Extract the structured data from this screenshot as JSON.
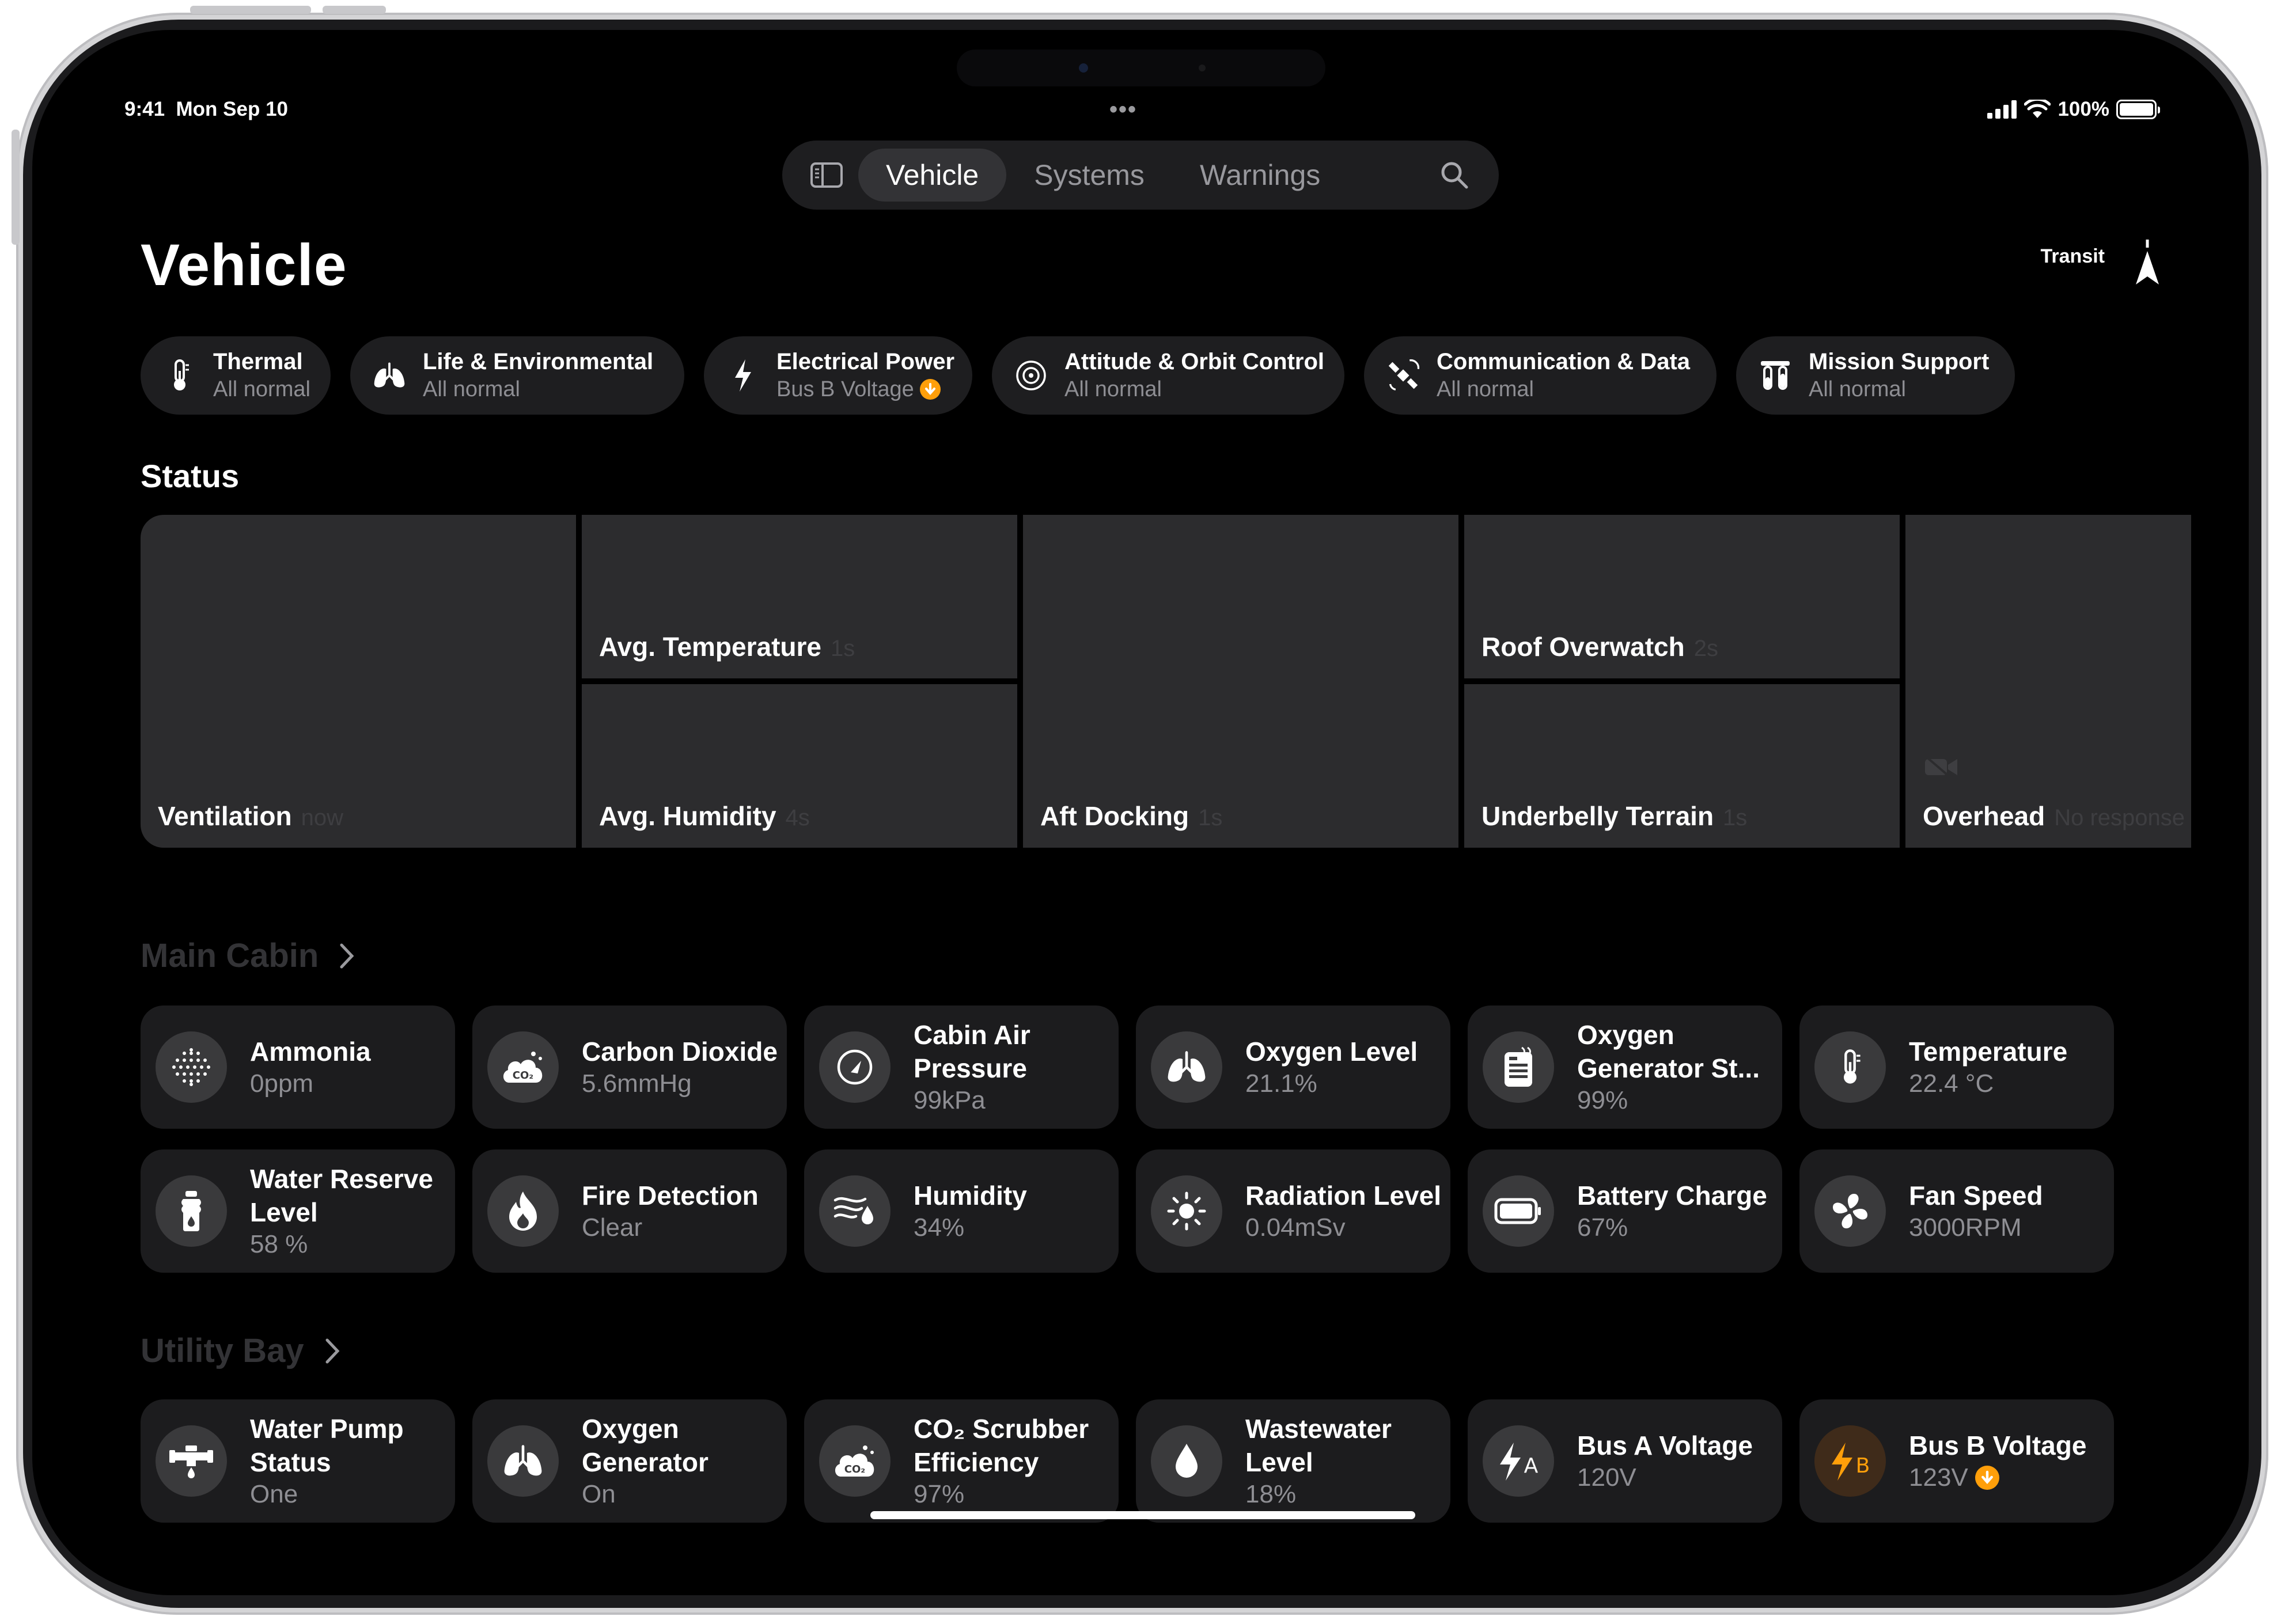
{
  "status_bar": {
    "time": "9:41",
    "date": "Mon Sep 10",
    "battery": "100%"
  },
  "tabs": [
    {
      "label": "Vehicle",
      "active": true
    },
    {
      "label": "Systems",
      "active": false
    },
    {
      "label": "Warnings",
      "active": false
    }
  ],
  "page_title": "Vehicle",
  "transit_label": "Transit",
  "categories": [
    {
      "icon": "thermometer-icon",
      "title": "Thermal",
      "status": "All normal"
    },
    {
      "icon": "lungs-icon",
      "title": "Life & Environmental",
      "status": "All normal"
    },
    {
      "icon": "bolt-icon",
      "title": "Electrical Power",
      "status": "Bus B Voltage",
      "warning": true
    },
    {
      "icon": "orbit-icon",
      "title": "Attitude & Orbit Control",
      "status": "All normal"
    },
    {
      "icon": "satellite-icon",
      "title": "Communication & Data",
      "status": "All normal"
    },
    {
      "icon": "test-tubes-icon",
      "title": "Mission Support",
      "status": "All normal"
    }
  ],
  "status_title": "Status",
  "cameras": [
    {
      "name": "Ventilation",
      "ago": "now"
    },
    {
      "name": "Avg. Temperature",
      "ago": "1s"
    },
    {
      "name": "Avg. Humidity",
      "ago": "4s"
    },
    {
      "name": "Aft Docking",
      "ago": "1s"
    },
    {
      "name": "Roof Overwatch",
      "ago": "2s"
    },
    {
      "name": "Underbelly Terrain",
      "ago": "1s"
    },
    {
      "name": "Overhead",
      "ago": "No response"
    }
  ],
  "main_cabin": {
    "title": "Main Cabin",
    "tiles": [
      {
        "icon": "dots-grid-icon",
        "name": "Ammonia",
        "value": "0ppm"
      },
      {
        "icon": "co2-cloud-icon",
        "name": "Carbon Dioxide",
        "value": "5.6mmHg"
      },
      {
        "icon": "gauge-icon",
        "name": "Cabin Air Pressure",
        "value": "99kPa"
      },
      {
        "icon": "lungs-icon",
        "name": "Oxygen Level",
        "value": "21.1%"
      },
      {
        "icon": "generator-icon",
        "name": "Oxygen Generator St...",
        "value": "99%"
      },
      {
        "icon": "thermometer-icon",
        "name": "Temperature",
        "value": "22.4 °C"
      },
      {
        "icon": "water-bottle-icon",
        "name": "Water Reserve Level",
        "value": "58 %"
      },
      {
        "icon": "flame-icon",
        "name": "Fire Detection",
        "value": "Clear"
      },
      {
        "icon": "humidity-icon",
        "name": "Humidity",
        "value": "34%"
      },
      {
        "icon": "sun-icon",
        "name": "Radiation Level",
        "value": "0.04mSv"
      },
      {
        "icon": "battery-icon",
        "name": "Battery Charge",
        "value": "67%"
      },
      {
        "icon": "fan-icon",
        "name": "Fan Speed",
        "value": "3000RPM"
      }
    ]
  },
  "utility_bay": {
    "title": "Utility Bay",
    "tiles": [
      {
        "icon": "pipe-valve-icon",
        "name": "Water Pump Status",
        "value": "One"
      },
      {
        "icon": "lungs-icon",
        "name": "Oxygen Generator",
        "value": "On"
      },
      {
        "icon": "co2-cloud-icon",
        "name": "CO₂ Scrubber Efficiency",
        "value": "97%"
      },
      {
        "icon": "drop-icon",
        "name": "Wastewater Level",
        "value": "18%"
      },
      {
        "icon": "bolt-a-icon",
        "name": "Bus A Voltage",
        "value": "120V",
        "badge": "A"
      },
      {
        "icon": "bolt-b-icon",
        "name": "Bus B Voltage",
        "value": "123V",
        "badge": "B",
        "warning": true
      }
    ]
  },
  "colors": {
    "background": "#000000",
    "tile": "#1c1c1e",
    "accent_warning": "#ff9f0a",
    "secondary_text": "#8e8e93"
  }
}
